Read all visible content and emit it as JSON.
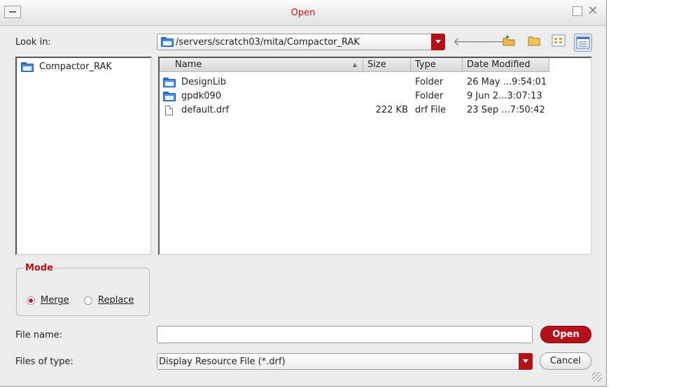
{
  "window": {
    "title": "Open"
  },
  "look_in": {
    "label": "Look in:",
    "path": "/servers/scratch03/mita/Compactor_RAK"
  },
  "toolbar": {
    "back_icon": "back-arrow-icon",
    "forward_icon": "forward-arrow-icon",
    "up_icon": "up-folder-icon",
    "new_folder_icon": "new-folder-icon",
    "list_view_icon": "list-view-icon",
    "details_view_icon": "details-view-icon"
  },
  "sidebar": {
    "items": [
      {
        "label": "Compactor_RAK",
        "icon": "folder-icon"
      }
    ]
  },
  "file_list": {
    "columns": [
      "Name",
      "Size",
      "Type",
      "Date Modified"
    ],
    "rows": [
      {
        "name": "DesignLib",
        "size": "",
        "type": "Folder",
        "modified": "26 May ...9:54:01",
        "icon": "folder-icon"
      },
      {
        "name": "gpdk090",
        "size": "",
        "type": "Folder",
        "modified": "9 Jun 2...3:07:13",
        "icon": "folder-icon"
      },
      {
        "name": "default.drf",
        "size": "222 KB",
        "type": "drf File",
        "modified": "23 Sep ...7:50:42",
        "icon": "file-icon"
      }
    ]
  },
  "mode": {
    "title": "Mode",
    "options": [
      {
        "label": "Merge",
        "selected": true
      },
      {
        "label": "Replace",
        "selected": false
      }
    ]
  },
  "file_name": {
    "label": "File name:",
    "value": ""
  },
  "file_type": {
    "label": "Files of type:",
    "value": "Display Resource File (*.drf)"
  },
  "buttons": {
    "open": "Open",
    "cancel": "Cancel"
  },
  "colors": {
    "accent": "#b5111a",
    "title": "#c0131b",
    "folder": "#4c8de0"
  }
}
